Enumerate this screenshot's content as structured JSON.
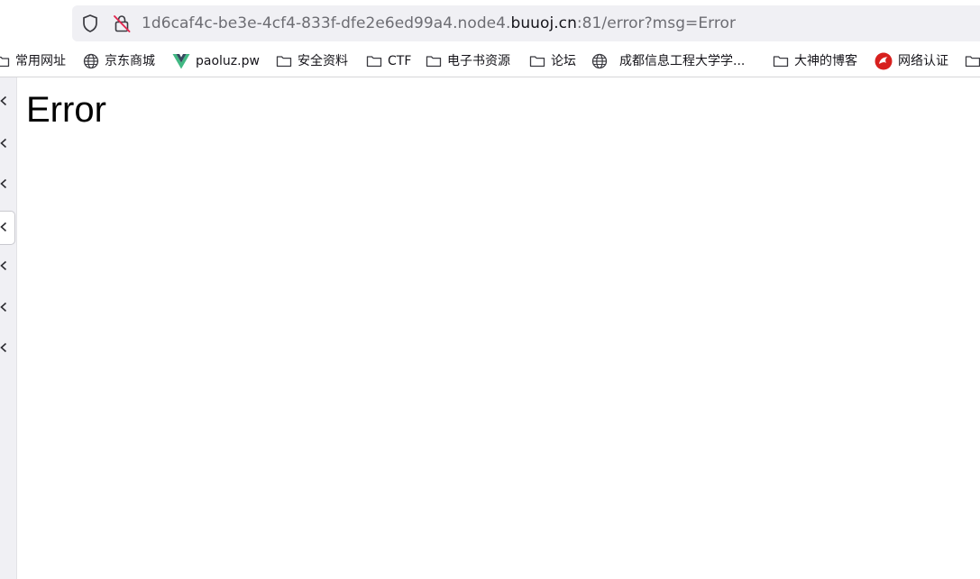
{
  "url": {
    "prefix": "1d6caf4c-be3e-4cf4-833f-dfe2e6ed99a4.node4.",
    "domain": "buuoj.cn",
    "suffix": ":81/error?msg=Error"
  },
  "bookmarks": [
    {
      "label": "常用网址",
      "icon": "folder-icon"
    },
    {
      "label": "京东商城",
      "icon": "globe-icon"
    },
    {
      "label": "paoluz.pw",
      "icon": "vue-logo-icon"
    },
    {
      "label": "安全资料",
      "icon": "folder-icon"
    },
    {
      "label": "CTF",
      "icon": "folder-icon"
    },
    {
      "label": "电子书资源",
      "icon": "folder-icon"
    },
    {
      "label": "论坛",
      "icon": "folder-icon"
    },
    {
      "label": "成都信息工程大学学...",
      "icon": "globe-icon"
    },
    {
      "label": "大神的博客",
      "icon": "folder-icon"
    },
    {
      "label": "网络认证",
      "icon": "red-logo-icon"
    },
    {
      "label": "",
      "icon": "folder-icon"
    }
  ],
  "sidebar": {
    "item_count": 7,
    "active_index": 3
  },
  "page": {
    "heading": "Error"
  },
  "colors": {
    "urlbar_bg": "#f0f0f4",
    "vue_green": "#41b883",
    "vue_dark": "#35495e",
    "lock_red": "#e22850",
    "red_logo": "#d7201e"
  }
}
